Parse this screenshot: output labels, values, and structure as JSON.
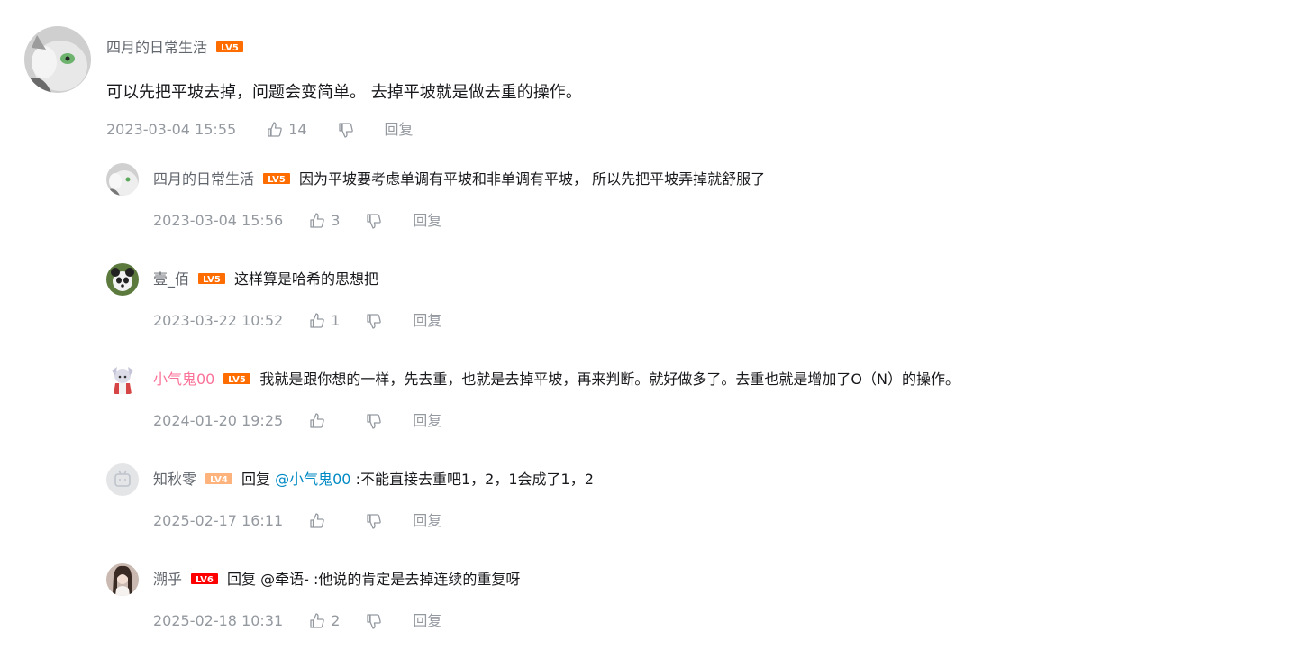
{
  "root_comment": {
    "user": "四月的日常生活",
    "level": "LV5",
    "level_color": "#ff6c00",
    "content": "可以先把平坡去掉，问题会变简单。 去掉平坡就是做去重的操作。",
    "time": "2023-03-04 15:55",
    "likes": "14",
    "reply_label": "回复"
  },
  "replies": [
    {
      "user": "四月的日常生活",
      "level": "LV5",
      "level_color": "#ff6c00",
      "content": "因为平坡要考虑单调有平坡和非单调有平坡， 所以先把平坡弄掉就舒服了",
      "time": "2023-03-04 15:56",
      "likes": "3",
      "reply_label": "回复"
    },
    {
      "user": "壹_佰",
      "level": "LV5",
      "level_color": "#ff6c00",
      "content": "这样算是哈希的思想把",
      "time": "2023-03-22 10:52",
      "likes": "1",
      "reply_label": "回复"
    },
    {
      "user": "小气鬼00",
      "user_color": "#fb7299",
      "level": "LV5",
      "level_color": "#ff6c00",
      "content": "我就是跟你想的一样，先去重，也就是去掉平坡，再来判断。就好做多了。去重也就是增加了O（N）的操作。",
      "time": "2024-01-20 19:25",
      "likes": "",
      "reply_label": "回复"
    },
    {
      "user": "知秋零",
      "level": "LV4",
      "level_color": "#ffb37c",
      "reply_prefix": "回复",
      "mention": "@小气鬼00",
      "mention_color": "#008ac5",
      "content": "不能直接去重吧1，2，1会成了1，2",
      "time": "2025-02-17 16:11",
      "likes": "",
      "reply_label": "回复"
    },
    {
      "user": "溯乎",
      "level": "LV6",
      "level_color": "#ff0000",
      "reply_prefix": "回复",
      "mention": "@牵语-",
      "content": "他说的肯定是去掉连续的重复呀",
      "time": "2025-02-18 10:31",
      "likes": "2",
      "reply_label": "回复"
    }
  ],
  "separator": ":",
  "icons": {
    "like": "thumbs-up-icon",
    "dislike": "thumbs-down-icon",
    "level_badge": "level-badge-icon"
  }
}
